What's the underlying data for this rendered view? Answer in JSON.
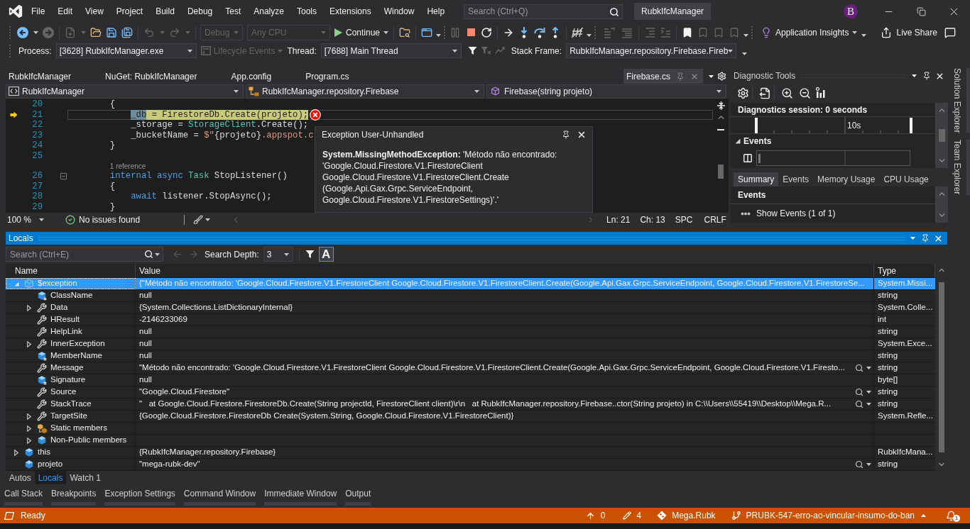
{
  "title_bar": {
    "menu": [
      "File",
      "Edit",
      "View",
      "Project",
      "Build",
      "Debug",
      "Test",
      "Analyze",
      "Tools",
      "Extensions",
      "Window",
      "Help"
    ],
    "search": {
      "placeholder": "Search (Ctrl+Q)"
    },
    "solution_name": "RubkIfcManager",
    "account_initial": "B"
  },
  "standard_toolbar": {
    "configuration": {
      "label": "Debug",
      "disabled": true
    },
    "platform": {
      "label": "Any CPU",
      "disabled": true
    },
    "continue": "Continue",
    "application_insights": "Application Insights",
    "live_share": "Live Share"
  },
  "debug_location": {
    "process_label": "Process:",
    "process": "[3628] RubkIfcManager.exe",
    "lifecycle_events": {
      "label": "Lifecycle Events",
      "disabled": true
    },
    "thread_label": "Thread:",
    "thread": "[7688] Main Thread",
    "stack_frame_label": "Stack Frame:",
    "stack_frame": "RubkIfcManager.repository.Firebase.Fireb"
  },
  "document_tabs": [
    {
      "label": "RubkIfcManager",
      "selected": false,
      "preview": false
    },
    {
      "label": "NuGet: RubkIfcManager",
      "selected": false,
      "preview": false
    },
    {
      "label": "App.config",
      "selected": false,
      "preview": false
    },
    {
      "label": "Program.cs",
      "selected": false,
      "preview": false
    },
    {
      "label": "Firebase.cs",
      "selected": true,
      "preview": true
    }
  ],
  "navigation_bar": {
    "project": "RubkIfcManager",
    "type": "RubkIfcManager.repository.Firebase",
    "member": "Firebase(string projeto)"
  },
  "code": {
    "lines": [
      {
        "kind": "code",
        "number": "20",
        "tokens": [
          {
            "text": "        {",
            "kind": "plain"
          }
        ],
        "current": false,
        "exception": false,
        "foldable": false
      },
      {
        "kind": "code",
        "number": "21",
        "tokens": [
          {
            "text": "            _db",
            "kind": "selection"
          },
          {
            "text": " = FirestoreDb.Create(projeto);",
            "kind": "statement"
          }
        ],
        "current": true,
        "exception": true,
        "foldable": false
      },
      {
        "kind": "code",
        "number": "22",
        "tokens": [
          {
            "text": "            _storage = ",
            "kind": "plain"
          },
          {
            "text": "StorageClient",
            "kind": "type"
          },
          {
            "text": ".Create();",
            "kind": "plain"
          }
        ],
        "current": false,
        "exception": false,
        "foldable": false
      },
      {
        "kind": "code",
        "number": "23",
        "tokens": [
          {
            "text": "            _bucketName = ",
            "kind": "plain"
          },
          {
            "text": "$\"",
            "kind": "string"
          },
          {
            "text": "{projeto}",
            "kind": "plain"
          },
          {
            "text": ".appspot.c",
            "kind": "string"
          }
        ],
        "current": false,
        "exception": false,
        "foldable": false
      },
      {
        "kind": "code",
        "number": "24",
        "tokens": [
          {
            "text": "        }",
            "kind": "plain"
          }
        ],
        "current": false,
        "exception": false,
        "foldable": false
      },
      {
        "kind": "code",
        "number": "25",
        "current": false,
        "exception": false,
        "foldable": false
      },
      {
        "kind": "codelens",
        "text": "1 reference"
      },
      {
        "kind": "code",
        "number": "26",
        "tokens": [
          {
            "text": "        internal",
            "kind": "keyword"
          },
          {
            "text": " async",
            "kind": "keyword"
          },
          {
            "text": " Task",
            "kind": "type"
          },
          {
            "text": " StopListener()",
            "kind": "plain"
          }
        ],
        "current": false,
        "exception": false,
        "foldable": true
      },
      {
        "kind": "code",
        "number": "27",
        "tokens": [
          {
            "text": "        {",
            "kind": "plain"
          }
        ],
        "current": false,
        "exception": false,
        "foldable": false
      },
      {
        "kind": "code",
        "number": "28",
        "tokens": [
          {
            "text": "            await",
            "kind": "keyword"
          },
          {
            "text": " listener.StopAsync();",
            "kind": "plain"
          }
        ],
        "current": false,
        "exception": false,
        "foldable": false
      },
      {
        "kind": "code",
        "number": "29",
        "tokens": [
          {
            "text": "        }",
            "kind": "plain"
          }
        ],
        "current": false,
        "exception": false,
        "foldable": false
      }
    ]
  },
  "exception_helper": {
    "title": "Exception User-Unhandled",
    "message": "**System.MissingMethodException:** 'Método não encontrado: 'Google.Cloud.Firestore.V1.FirestoreClient Google.Cloud.Firestore.V1.FirestoreClient.Create (Google.Api.Gax.Grpc.ServiceEndpoint, Google.Cloud.Firestore.V1.FirestoreSettings)'.'"
  },
  "editor_status": {
    "zoom": "100 %",
    "issues": "No issues found",
    "line": "Ln: 21",
    "column": "Ch: 13",
    "indent": "SPC",
    "line_endings": "CRLF"
  },
  "diagnostic_tools": {
    "title": "Diagnostic Tools",
    "session": "Diagnostics session: 0 seconds",
    "timeline_label": "10s",
    "events_group": {
      "label": "Events",
      "expanded": true
    },
    "tabs": [
      {
        "label": "Summary",
        "selected": true
      },
      {
        "label": "Events",
        "selected": false
      },
      {
        "label": "Memory Usage",
        "selected": false
      },
      {
        "label": "CPU Usage",
        "selected": false
      }
    ],
    "summary_heading": "Events",
    "show_events": "Show Events (1 of 1)"
  },
  "side_tabs": [
    "Solution Explorer",
    "Team Explorer"
  ],
  "locals": {
    "title": "Locals",
    "search": {
      "placeholder": "Search (Ctrl+E)"
    },
    "search_depth_label": "Search Depth:",
    "search_depth": "3",
    "case_toggle": {
      "label": "A",
      "on": true
    },
    "columns": [
      "Name",
      "Value",
      "Type"
    ],
    "rows": [
      {
        "name": "$exception",
        "value": "{\"Método não encontrado: 'Google.Cloud.Firestore.V1.FirestoreClient Google.Cloud.Firestore.V1.FirestoreClient.Create(Google.Api.Gax.Grpc.ServiceEndpoint, Google.Cloud.Firestore.V1.FirestoreSe...",
        "type": "System.Missi...",
        "kind": "exception",
        "selected": true,
        "expanded": true,
        "children": [
          {
            "name": "ClassName",
            "value": "null",
            "type": "string",
            "kind": "field",
            "selected": false
          },
          {
            "name": "Data",
            "value": "{System.Collections.ListDictionaryInternal}",
            "type": "System.Colle...",
            "kind": "property",
            "selected": false,
            "expanded": false
          },
          {
            "name": "HResult",
            "value": "-2146233069",
            "type": "int",
            "kind": "property",
            "selected": false
          },
          {
            "name": "HelpLink",
            "value": "null",
            "type": "string",
            "kind": "property",
            "selected": false
          },
          {
            "name": "InnerException",
            "value": "null",
            "type": "System.Exce...",
            "kind": "property",
            "selected": false,
            "expanded": false
          },
          {
            "name": "MemberName",
            "value": "null",
            "type": "string",
            "kind": "field",
            "selected": false
          },
          {
            "name": "Message",
            "value": "\"Método não encontrado: 'Google.Cloud.Firestore.V1.FirestoreClient Google.Cloud.Firestore.V1.FirestoreClient.Create(Google.Api.Gax.Grpc.ServiceEndpoint, Google.Cloud.Firestore.V1.Firesto...",
            "type": "string",
            "kind": "property",
            "selected": false,
            "visualizer": true
          },
          {
            "name": "Signature",
            "value": "null",
            "type": "byte[]",
            "kind": "field",
            "selected": false
          },
          {
            "name": "Source",
            "value": "\"Google.Cloud.Firestore\"",
            "type": "string",
            "kind": "property",
            "selected": false,
            "visualizer": true
          },
          {
            "name": "StackTrace",
            "value": "\"   at Google.Cloud.Firestore.FirestoreDb.Create(String projectId, FirestoreClient client)\\r\\n   at RubkIfcManager.repository.Firebase..ctor(String projeto) in C:\\\\Users\\\\55419\\\\Desktop\\\\Mega.R...",
            "type": "string",
            "kind": "property",
            "selected": false,
            "visualizer": true
          },
          {
            "name": "TargetSite",
            "value": "{Google.Cloud.Firestore.FirestoreDb Create(System.String, Google.Cloud.Firestore.V1.FirestoreClient)}",
            "type": "System.Refle...",
            "kind": "property",
            "selected": false,
            "expanded": false
          },
          {
            "name": "Static members",
            "kind": "static",
            "selected": false,
            "expanded": false
          },
          {
            "name": "Non-Public members",
            "kind": "object",
            "selected": false,
            "expanded": false
          }
        ]
      },
      {
        "name": "this",
        "value": "{RubkIfcManager.repository.Firebase}",
        "type": "RubkIfcMana...",
        "kind": "object",
        "selected": false,
        "expanded": false
      },
      {
        "name": "projeto",
        "value": "\"mega-rubk-dev\"",
        "type": "string",
        "kind": "object",
        "selected": false,
        "visualizer": true
      }
    ],
    "debug_tabs": [
      {
        "label": "Autos",
        "selected": false
      },
      {
        "label": "Locals",
        "selected": true
      },
      {
        "label": "Watch 1",
        "selected": false
      }
    ]
  },
  "tool_windows": [
    "Call Stack",
    "Breakpoints",
    "Exception Settings",
    "Command Window",
    "Immediate Window",
    "Output"
  ],
  "status_bar": {
    "text": "Ready",
    "unpushed": "0",
    "changes": "4",
    "repository": "Mega.Rubk",
    "branch": "PRUBK-547-erro-ao-vincular-insumo-do-ban",
    "notifications": "1"
  }
}
